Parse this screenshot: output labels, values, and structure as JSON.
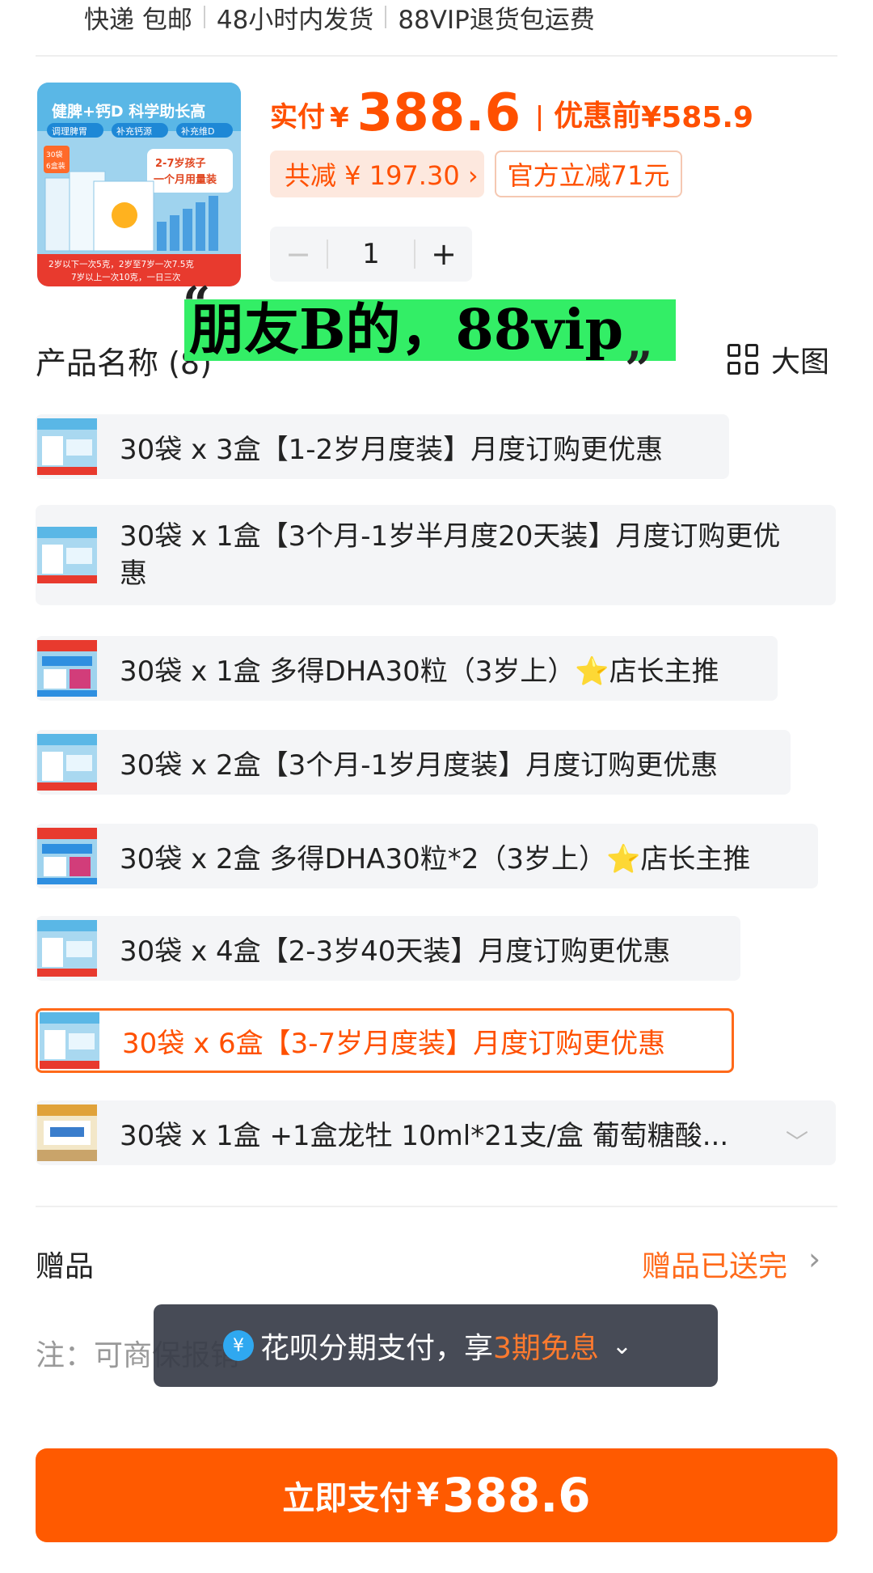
{
  "shipping": {
    "items": [
      "快递 包邮",
      "48小时内发货",
      "88VIP退货包运费"
    ]
  },
  "product": {
    "thumb_headline": "健脾+钙D 科学助长高",
    "thumb_badges": [
      "调理脾胃",
      "补充钙源",
      "补充维D"
    ],
    "thumb_side": "2-7岁孩子 一个月用量装",
    "thumb_box_label": "30袋 6盒装",
    "thumb_footer": "2岁以下一次5克，2岁至7岁一次7.5克 7岁以上一次10克，一日三次"
  },
  "price": {
    "paid_label": "实付",
    "currency": "¥",
    "paid_amount": "388.6",
    "before_label": "优惠前",
    "before_amount": "¥585.9",
    "total_discount": "共减 ¥ 197.30 ›",
    "official_discount": "官方立减71元"
  },
  "quantity": {
    "minus": "−",
    "value": "1",
    "plus": "+"
  },
  "annotation": {
    "open_quote": "“",
    "text": "朋友B的，88vip",
    "close_quote": "„"
  },
  "section": {
    "title": "产品名称 (8)",
    "big_view": "大图"
  },
  "options": [
    {
      "label": "30袋 x 3盒【1-2岁月度装】月度订购更优惠",
      "selected": false
    },
    {
      "label": "30袋 x 1盒【3个月-1岁半月度20天装】月度订购更优惠",
      "selected": false
    },
    {
      "label_before_star": "30袋 x 1盒 多得DHA30粒（3岁上）",
      "star": "⭐",
      "label_after_star": "店长主推",
      "selected": false
    },
    {
      "label": "30袋 x 2盒【3个月-1岁月度装】月度订购更优惠",
      "selected": false
    },
    {
      "label_before_star": "30袋 x 2盒 多得DHA30粒*2（3岁上）",
      "star": "⭐",
      "label_after_star": "店长主推",
      "selected": false
    },
    {
      "label": "30袋 x 4盒【2-3岁40天装】月度订购更优惠",
      "selected": false
    },
    {
      "label": "30袋 x 6盒【3-7岁月度装】月度订购更优惠",
      "selected": true
    },
    {
      "label": "30袋 x 1盒 +1盒龙牡 10ml*21支/盒 葡萄糖酸...",
      "selected": false
    }
  ],
  "gift": {
    "label": "赠品",
    "status": "赠品已送完",
    "arrow": "›"
  },
  "note": "注：可商保报销",
  "toast": {
    "icon": "¥",
    "text": "花呗分期支付，享",
    "highlight": "3期免息",
    "chevron": "⌄"
  },
  "pay_button": {
    "label": "立即支付",
    "currency": "¥",
    "amount": "388.6"
  },
  "colors": {
    "accent": "#ff5000",
    "selected_border": "#ff6a1a",
    "option_bg": "#f4f5f7",
    "annotation_bg": "#33ee66"
  }
}
